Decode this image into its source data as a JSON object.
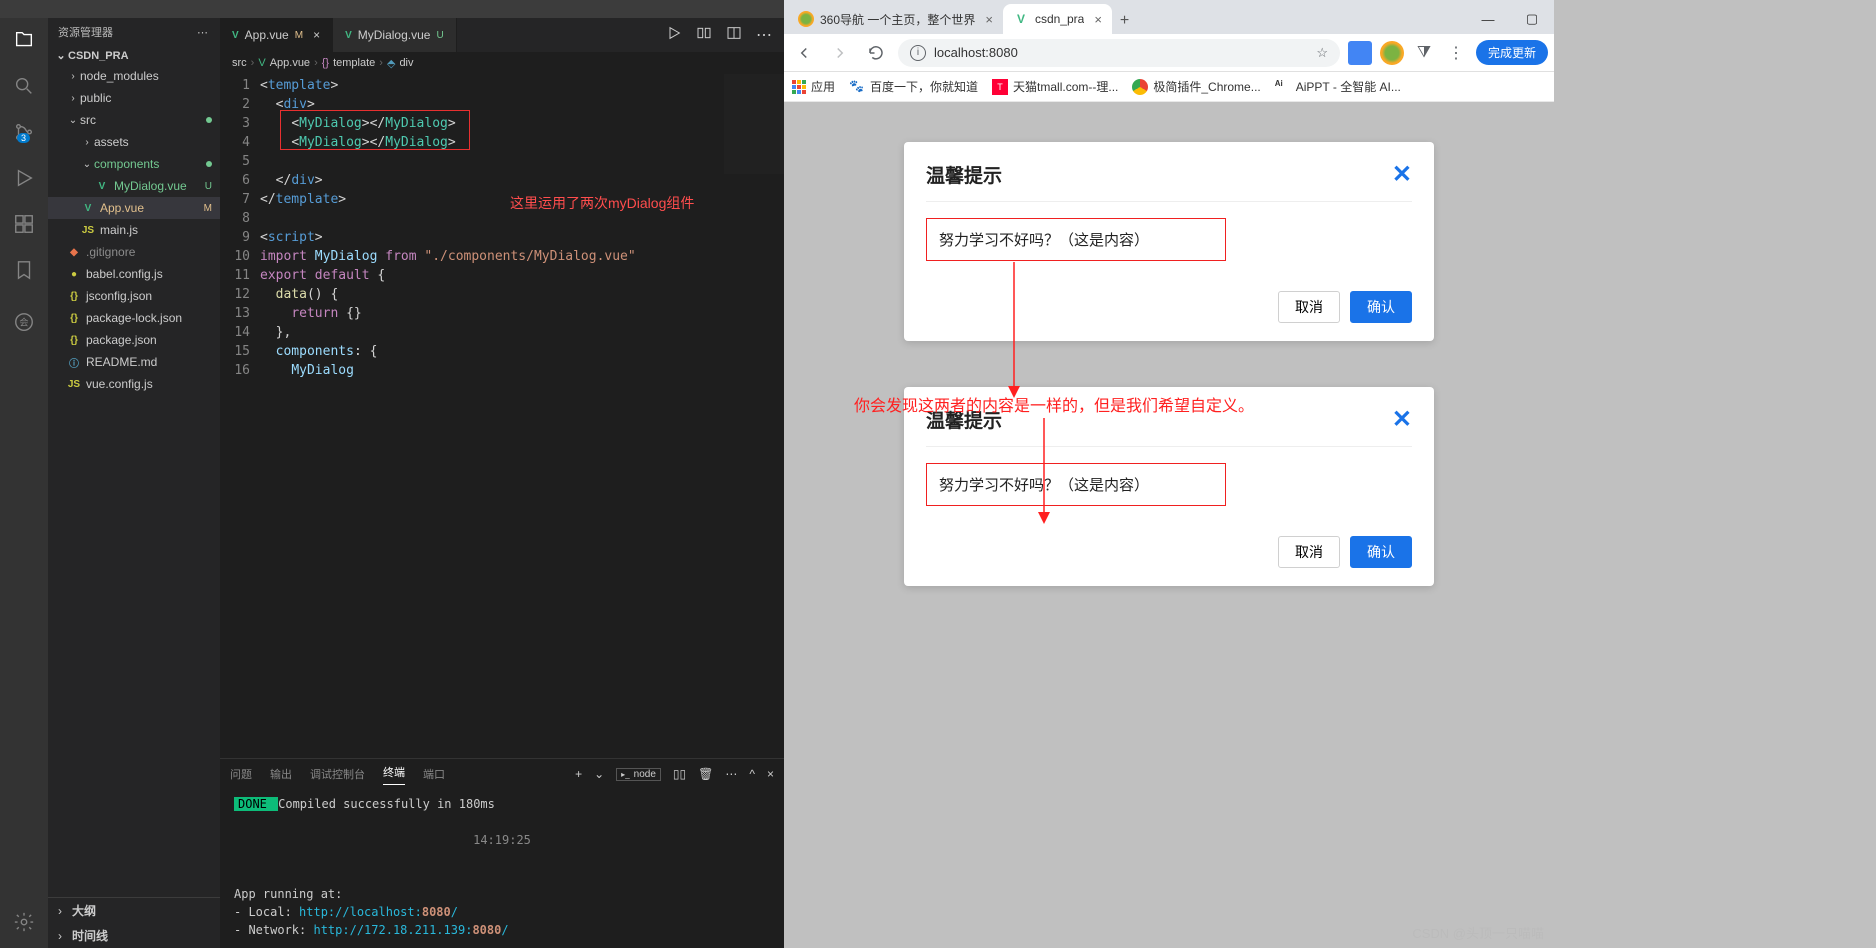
{
  "vscode": {
    "explorer_title": "资源管理器",
    "project": "CSDN_PRA",
    "tree": {
      "node_modules": "node_modules",
      "public": "public",
      "src": "src",
      "assets": "assets",
      "components": "components",
      "mydialog": "MyDialog.vue",
      "appvue": "App.vue",
      "mainjs": "main.js",
      "gitignore": ".gitignore",
      "babel": "babel.config.js",
      "jsconfig": "jsconfig.json",
      "pkglock": "package-lock.json",
      "pkg": "package.json",
      "readme": "README.md",
      "vueconfig": "vue.config.js",
      "status_U": "U",
      "status_M": "M"
    },
    "outline": "大纲",
    "timeline": "时间线",
    "tabs": {
      "app": "App.vue",
      "mydialog": "MyDialog.vue",
      "status_M": "M",
      "status_U": "U"
    },
    "crumbs": {
      "src": "src",
      "app": "App.vue",
      "template": "template",
      "div": "div"
    },
    "code": {
      "l1": "<template>",
      "l2": "  <div>",
      "l3": "    <MyDialog></MyDialog>",
      "l4": "    <MyDialog></MyDialog>",
      "l5": "",
      "l6": "  </div>",
      "l7": "</template>",
      "l9": "<script>",
      "l10a": "import ",
      "l10b": "MyDialog",
      "l10c": " from ",
      "l10d": "\"./components/MyDialog.vue\"",
      "l11": "export default {",
      "l12": "  data() {",
      "l13": "    return {}",
      "l14": "  },",
      "l15": "  components: {",
      "l16": "    MyDialog"
    },
    "annotation1": "这里运用了两次myDialog组件",
    "panel": {
      "problems": "问题",
      "output": "输出",
      "debug": "调试控制台",
      "terminal": "终端",
      "ports": "端口",
      "node": "node"
    },
    "terminal": {
      "done": " DONE ",
      "compiled": " Compiled successfully in 180ms",
      "timestamp": "14:19:25",
      "running": "App running at:",
      "local_lbl": "- Local:   ",
      "local_url": "http://localhost:",
      "local_port": "8080",
      "local_slash": "/",
      "net_lbl": "- Network: ",
      "net_url": "http://172.18.211.139:",
      "net_port": "8080",
      "net_slash": "/"
    },
    "scm_badge": "3"
  },
  "browser": {
    "tabs": {
      "t1": "360导航 一个主页，整个世界",
      "t2": "csdn_pra"
    },
    "url": "localhost:8080",
    "update": "完成更新",
    "bookmarks": {
      "apps": "应用",
      "baidu": "百度一下，你就知道",
      "tmall": "天猫tmall.com--理...",
      "chrome": "极简插件_Chrome...",
      "aippt": "AiPPT - 全智能 AI..."
    },
    "dialog": {
      "title": "温馨提示",
      "content": "努力学习不好吗？（这是内容）",
      "cancel": "取消",
      "confirm": "确认"
    },
    "callout": "你会发现这两者的内容是一样的，但是我们希望自定义。",
    "watermark": "CSDN @头顶一只喵喵"
  }
}
